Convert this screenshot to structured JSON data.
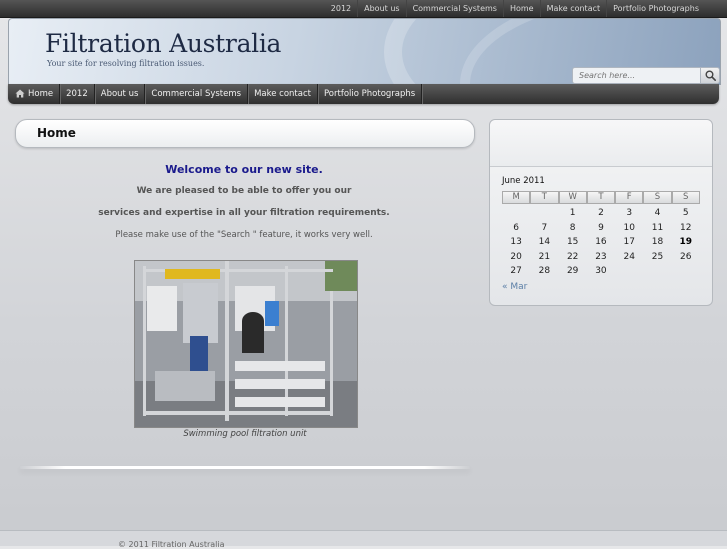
{
  "top_nav": {
    "items": [
      "2012",
      "About us",
      "Commercial Systems",
      "Home",
      "Make contact",
      "Portfolio Photographs"
    ]
  },
  "header": {
    "site_title": "Filtration Australia",
    "tagline": "Your site for resolving filtration issues.",
    "search_placeholder": "Search here..."
  },
  "main_nav": {
    "home_icon": "house-icon",
    "items": [
      "Home",
      "2012",
      "About us",
      "Commercial Systems",
      "Make contact",
      "Portfolio Photographs"
    ]
  },
  "content": {
    "title": "Home",
    "welcome": "Welcome to our new site.",
    "line1": "We are pleased to be able to offer you our",
    "line2": "services and expertise in all your filtration requirements.",
    "line3": "Please make use of the \"Search \" feature, it works very well.",
    "image_caption": "Swimming pool filtration unit"
  },
  "calendar": {
    "caption": "June 2011",
    "weekdays": [
      "M",
      "T",
      "W",
      "T",
      "F",
      "S",
      "S"
    ],
    "weeks": [
      [
        "",
        "",
        "1",
        "2",
        "3",
        "4",
        "5"
      ],
      [
        "6",
        "7",
        "8",
        "9",
        "10",
        "11",
        "12"
      ],
      [
        "13",
        "14",
        "15",
        "16",
        "17",
        "18",
        "19"
      ],
      [
        "20",
        "21",
        "22",
        "23",
        "24",
        "25",
        "26"
      ],
      [
        "27",
        "28",
        "29",
        "30",
        "",
        "",
        ""
      ]
    ],
    "today": "19",
    "prev_link": "« Mar"
  },
  "footer": {
    "text": "© 2011 Filtration Australia"
  },
  "colors": {
    "welcome": "#1a1a8c",
    "link": "#5b7fa6",
    "nav_bg": "#2f2f2f"
  }
}
